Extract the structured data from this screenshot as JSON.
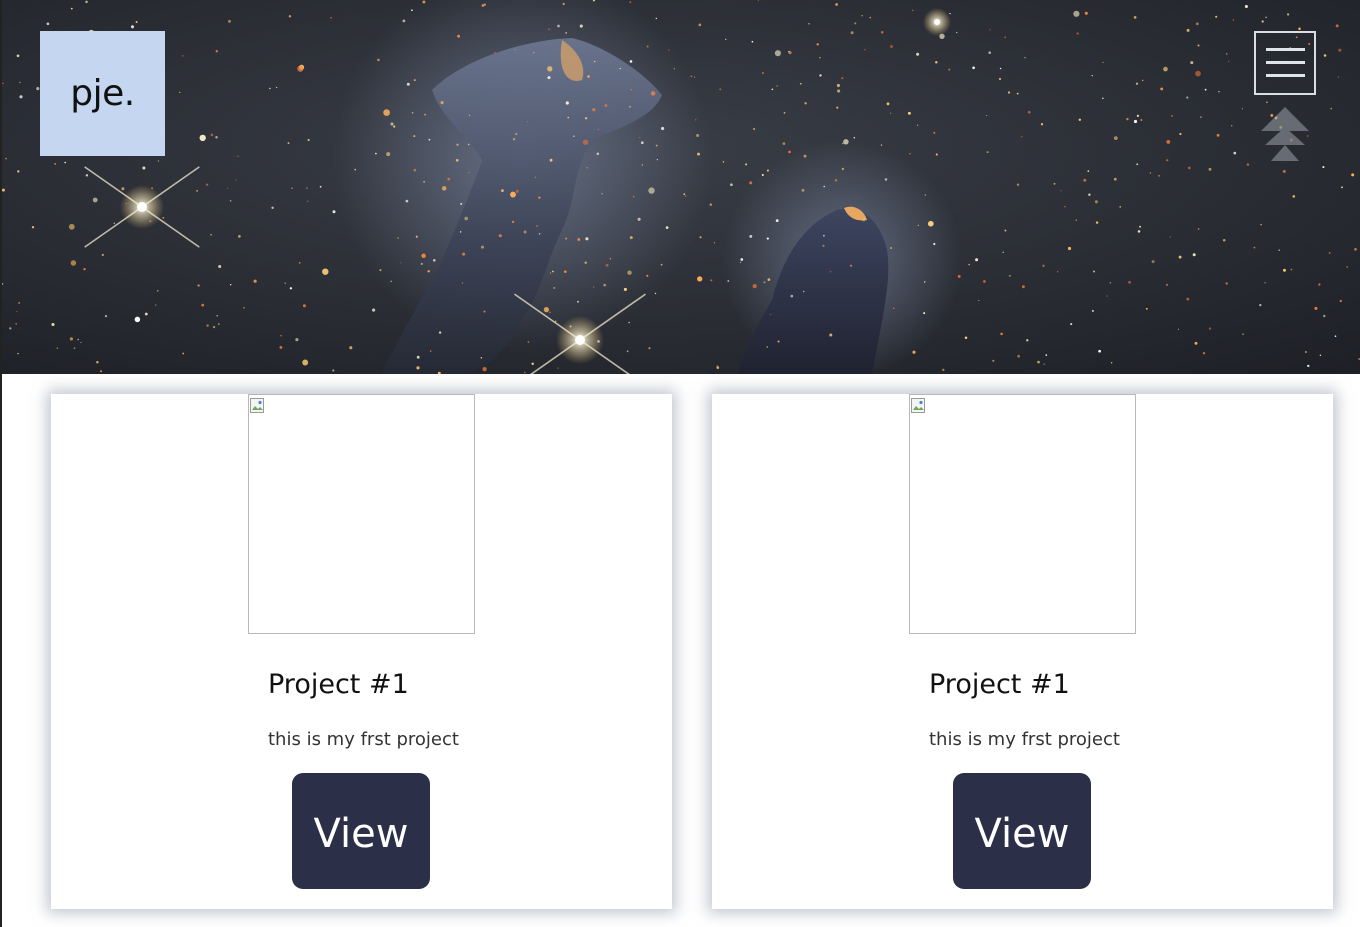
{
  "header": {
    "logo_text": "pje.",
    "menu_icon": "hamburger-menu-icon",
    "scroll_icon": "double-chevron-up-icon"
  },
  "projects": [
    {
      "title": "Project #1",
      "description": "this is my frst project",
      "button_label": "View",
      "image_icon": "broken-image-icon"
    },
    {
      "title": "Project #1",
      "description": "this is my frst project",
      "button_label": "View",
      "image_icon": "broken-image-icon"
    }
  ],
  "colors": {
    "logo_bg": "#c5d6f1",
    "button_bg": "#2b2f48",
    "button_text": "#ffffff",
    "hero_base": "#2a2d33"
  }
}
